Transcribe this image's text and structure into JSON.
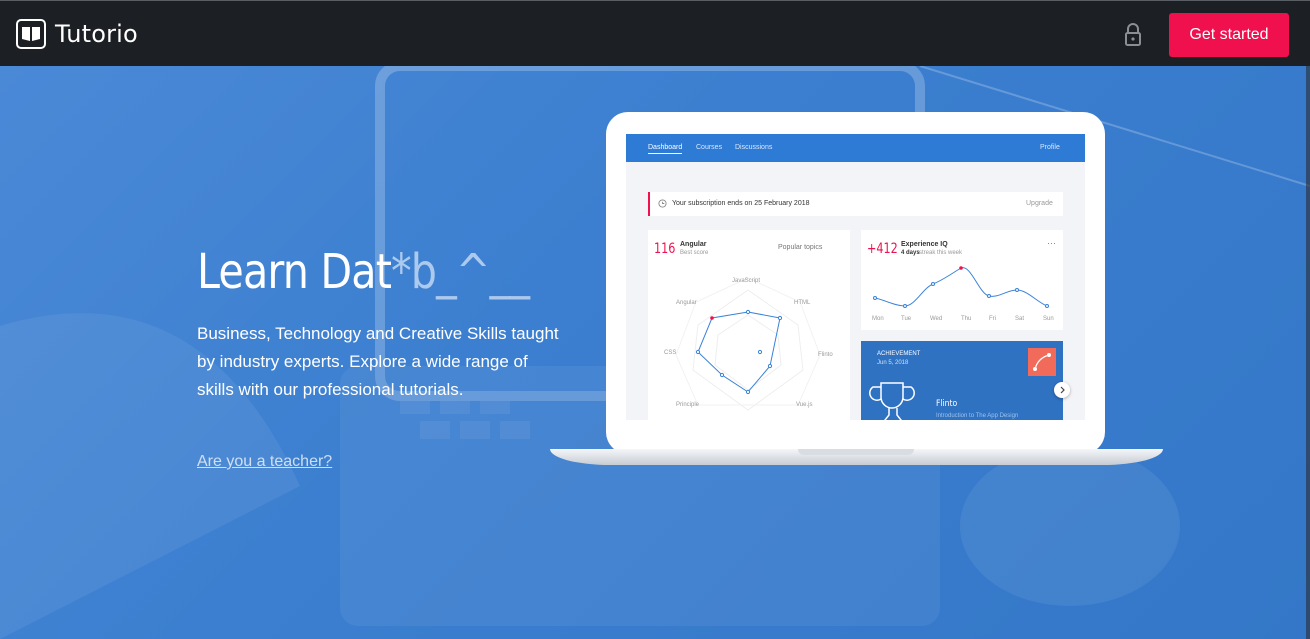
{
  "navbar": {
    "brand": "Tutorio",
    "cta_label": "Get started"
  },
  "hero": {
    "title_main": "Learn Dat",
    "title_cursor": "*b_^__",
    "subtitle": "Business, Technology and Creative Skills taught by industry experts. Explore a wide range of skills with our professional tutorials.",
    "teacher_link": "Are you a teacher?"
  },
  "mockup": {
    "nav": {
      "dashboard": "Dashboard",
      "courses": "Courses",
      "discussions": "Discussions",
      "profile": "Profile"
    },
    "subscription": {
      "text": "Your subscription ends on 25 February 2018",
      "upgrade": "Upgrade"
    },
    "angular_card": {
      "score": "116",
      "name": "Angular",
      "sub": "Best score",
      "filter": "Popular topics",
      "axes": [
        "JavaScript",
        "HTML",
        "Flinto",
        "Vue.js",
        "Principle",
        "CSS",
        "Angular"
      ]
    },
    "iq_card": {
      "score": "+412",
      "name": "Experience IQ",
      "sub_bold": "4 days",
      "sub": "streak this week",
      "days": [
        "Mon",
        "Tue",
        "Wed",
        "Thu",
        "Fri",
        "Sat",
        "Sun"
      ]
    },
    "achievement": {
      "label": "ACHIEVEMENT",
      "date": "Jun 5, 2018",
      "title": "Flinto",
      "desc": "Introduction to The App Design"
    }
  },
  "colors": {
    "navbar_bg": "#1c1f24",
    "accent": "#f0104e",
    "hero_blue": "#3a7fd0"
  },
  "icons": [
    "book-logo-icon",
    "lock-icon",
    "clock-icon",
    "more-icon",
    "chevron-right-icon",
    "pen-tool-icon",
    "trophy-icon"
  ]
}
